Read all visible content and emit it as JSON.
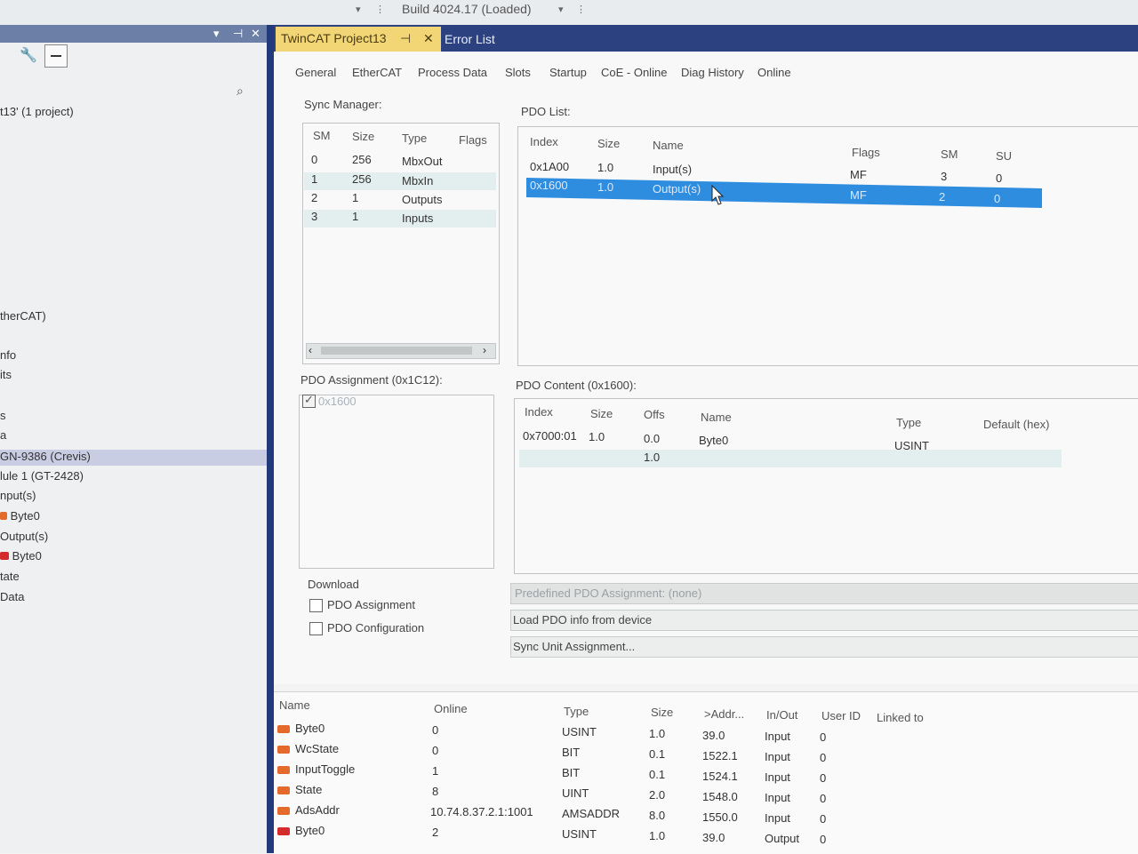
{
  "toolbar": {
    "build_label": "Build 4024.17 (Loaded)"
  },
  "tabs": {
    "project": "TwinCAT Project13",
    "project_pin": "⊣",
    "project_close": "✕",
    "errors": "Error List"
  },
  "left_pane": {
    "project_label": "t13' (1 project)",
    "items": [
      "therCAT)",
      "nfo",
      "its",
      "s",
      "a"
    ],
    "device": "GN-9386 (Crevis)",
    "module": "lule 1 (GT-2428)",
    "inputs": "nput(s)",
    "in_byte": "Byte0",
    "outputs": "Output(s)",
    "out_byte": "Byte0",
    "state": "tate",
    "data": "Data"
  },
  "subtabs": [
    "General",
    "EtherCAT",
    "Process Data",
    "Slots",
    "Startup",
    "CoE - Online",
    "Diag History",
    "Online"
  ],
  "sync_manager": {
    "title": "Sync Manager:",
    "headers": [
      "SM",
      "Size",
      "Type",
      "Flags"
    ],
    "rows": [
      [
        "0",
        "256",
        "MbxOut",
        ""
      ],
      [
        "1",
        "256",
        "MbxIn",
        ""
      ],
      [
        "2",
        "1",
        "Outputs",
        ""
      ],
      [
        "3",
        "1",
        "Inputs",
        ""
      ]
    ]
  },
  "pdo_list": {
    "title": "PDO List:",
    "headers": [
      "Index",
      "Size",
      "Name",
      "Flags",
      "SM",
      "SU"
    ],
    "rows": [
      [
        "0x1A00",
        "1.0",
        "Input(s)",
        "MF",
        "3",
        "0"
      ],
      [
        "0x1600",
        "1.0",
        "Output(s)",
        "MF",
        "2",
        "0"
      ]
    ]
  },
  "pdo_assignment": {
    "title": "PDO Assignment (0x1C12):",
    "item": "0x1600"
  },
  "pdo_content": {
    "title": "PDO Content (0x1600):",
    "headers": [
      "Index",
      "Size",
      "Offs",
      "Name",
      "Type",
      "Default (hex)"
    ],
    "rows": [
      [
        "0x7000:01",
        "1.0",
        "0.0",
        "Byte0",
        "USINT",
        ""
      ],
      [
        "",
        "",
        "1.0",
        "",
        "",
        ""
      ]
    ]
  },
  "download": {
    "title": "Download",
    "opt1": "PDO Assignment",
    "opt2": "PDO Configuration"
  },
  "buttons": {
    "predefined": "Predefined PDO Assignment: (none)",
    "load": "Load PDO info from device",
    "sync_unit": "Sync Unit Assignment..."
  },
  "variables": {
    "headers": [
      "Name",
      "Online",
      "Type",
      "Size",
      ">Addr...",
      "In/Out",
      "User ID",
      "Linked to"
    ],
    "rows": [
      [
        "Byte0",
        "0",
        "USINT",
        "1.0",
        "39.0",
        "Input",
        "0"
      ],
      [
        "WcState",
        "0",
        "BIT",
        "0.1",
        "1522.1",
        "Input",
        "0"
      ],
      [
        "InputToggle",
        "1",
        "BIT",
        "0.1",
        "1524.1",
        "Input",
        "0"
      ],
      [
        "State",
        "8",
        "UINT",
        "2.0",
        "1548.0",
        "Input",
        "0"
      ],
      [
        "AdsAddr",
        "10.74.8.37.2.1:1001",
        "AMSADDR",
        "8.0",
        "1550.0",
        "Input",
        "0"
      ],
      [
        "Byte0",
        "2",
        "USINT",
        "1.0",
        "39.0",
        "Output",
        "0"
      ]
    ]
  }
}
